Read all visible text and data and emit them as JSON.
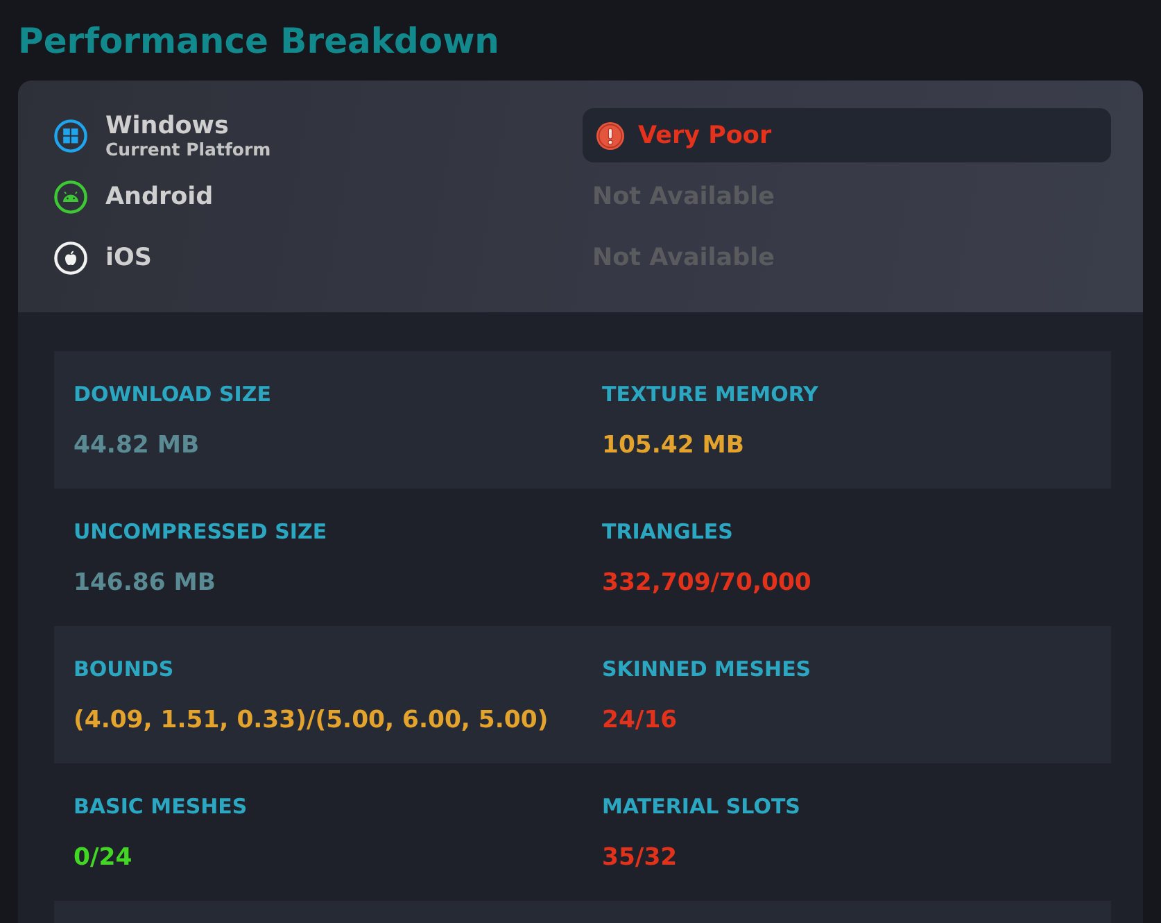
{
  "title": "Performance Breakdown",
  "platforms": [
    {
      "kind": "windows",
      "name": "Windows",
      "subtitle": "Current Platform",
      "status": "Very Poor",
      "available": true
    },
    {
      "kind": "android",
      "name": "Android",
      "status": "Not Available",
      "available": false
    },
    {
      "kind": "apple",
      "name": "iOS",
      "status": "Not Available",
      "available": false
    }
  ],
  "stats": [
    {
      "label": "DOWNLOAD SIZE",
      "value": "44.82 MB",
      "color": "#5a8a93"
    },
    {
      "label": "TEXTURE MEMORY",
      "value": "105.42 MB",
      "color": "#e3a32d"
    },
    {
      "label": "UNCOMPRESSED SIZE",
      "value": "146.86 MB",
      "color": "#5a8a93"
    },
    {
      "label": "TRIANGLES",
      "value": "332,709/70,000",
      "color": "#e2321b"
    },
    {
      "label": "BOUNDS",
      "value": "(4.09, 1.51, 0.33)/(5.00, 6.00, 5.00)",
      "color": "#e3a32d"
    },
    {
      "label": "SKINNED MESHES",
      "value": "24/16",
      "color": "#e2321b"
    },
    {
      "label": "BASIC MESHES",
      "value": "0/24",
      "color": "#41d723"
    },
    {
      "label": "MATERIAL SLOTS",
      "value": "35/32",
      "color": "#e2321b"
    }
  ]
}
